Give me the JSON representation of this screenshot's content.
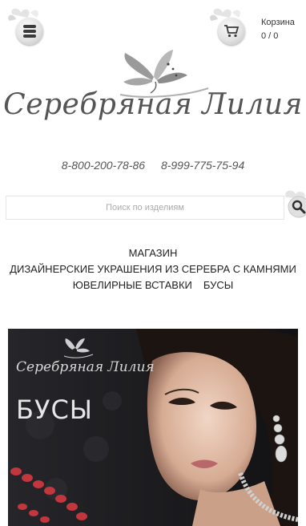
{
  "header": {
    "menu_icon": "stack-menu-icon",
    "cart_icon": "cart-icon",
    "cart_label": "Корзина",
    "cart_count": "0 / 0"
  },
  "logo": {
    "text": "Серебряная Лилия"
  },
  "phones": [
    "8-800-200-78-86",
    "8-999-775-75-94"
  ],
  "search": {
    "placeholder": "Поиск по изделиям",
    "button_icon": "magnifier-icon"
  },
  "nav": {
    "items": [
      "МАГАЗИН",
      "ДИЗАЙНЕРСКИЕ УКРАШЕНИЯ ИЗ СЕРЕБРА С КАМНЯМИ",
      "ЮВЕЛИРНЫЕ ВСТАВКИ",
      "БУСЫ"
    ]
  },
  "banner": {
    "logo_text": "Серебряная Лилия",
    "title": "БУСЫ"
  },
  "colors": {
    "text": "#333333",
    "banner_bg": "#1a1a1c",
    "bead_red": "#c2363e"
  }
}
